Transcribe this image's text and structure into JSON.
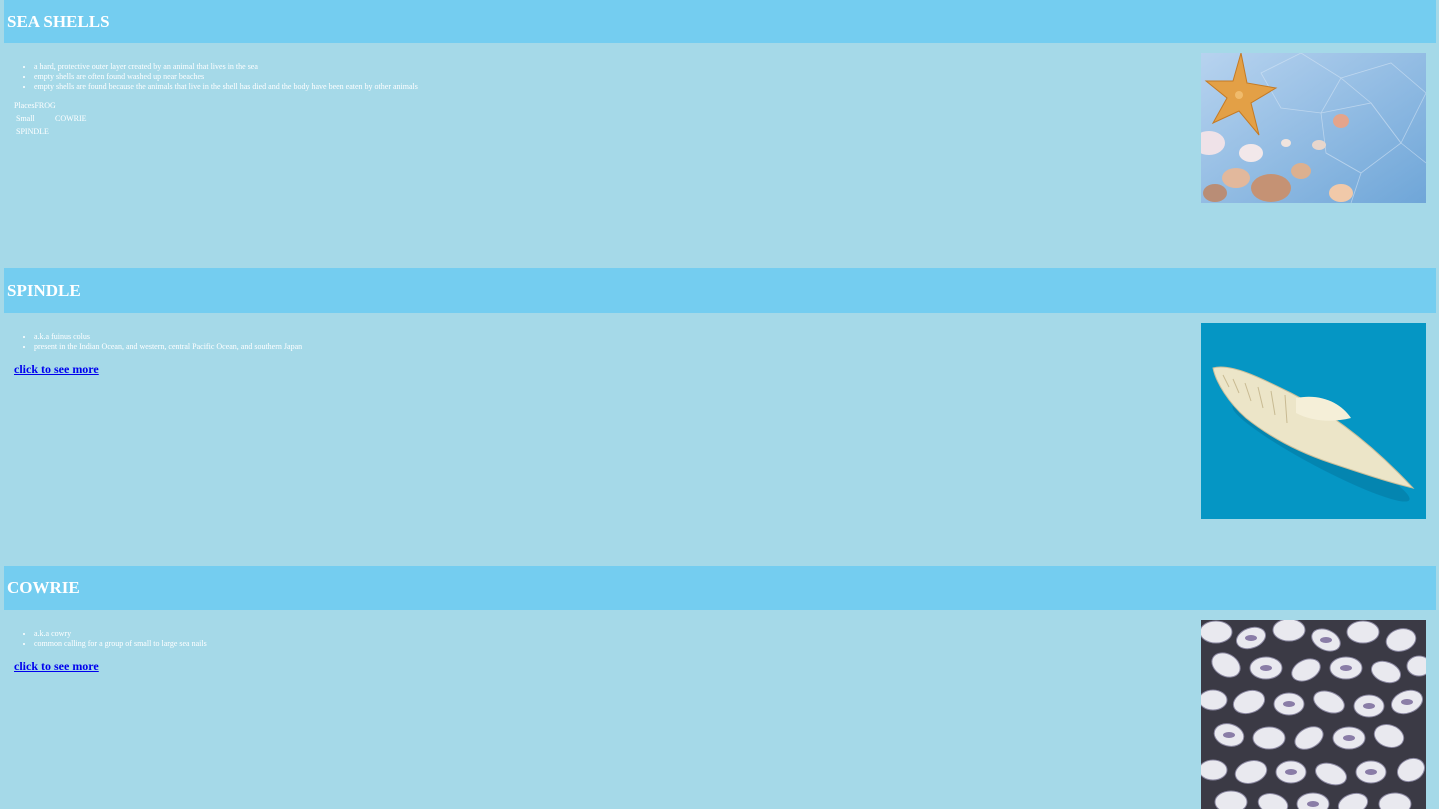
{
  "sections": [
    {
      "title": "SEA SHELLS",
      "bullets": [
        "a hard, protective outer layer created by an animal that lives in the sea",
        "empty shells are often found washed up near beaches",
        "empty shells are found because the animals that live in the shell has died and the body have been eaten by other animals"
      ],
      "table": {
        "caption": "PlacesFROG",
        "rows": [
          [
            "Small",
            "COWRIE"
          ],
          [
            "SPINDLE",
            ""
          ]
        ]
      },
      "image_icon": "starfish-and-shells-photo"
    },
    {
      "title": "SPINDLE",
      "bullets": [
        "a.k.a fuinus colus",
        "present in the Indian Ocean, and western, central Pacific Ocean, and southern Japan"
      ],
      "link": "click to see more",
      "image_icon": "spindle-shell-photo"
    },
    {
      "title": "COWRIE",
      "bullets": [
        "a.k.a cowry",
        "common calling for a group of small to large sea nails"
      ],
      "link": "click to see more",
      "image_icon": "cowrie-shells-photo"
    }
  ],
  "colors": {
    "page_background": "#a5d9e8",
    "header_background": "#74cdf0",
    "link": "#0000ee"
  }
}
